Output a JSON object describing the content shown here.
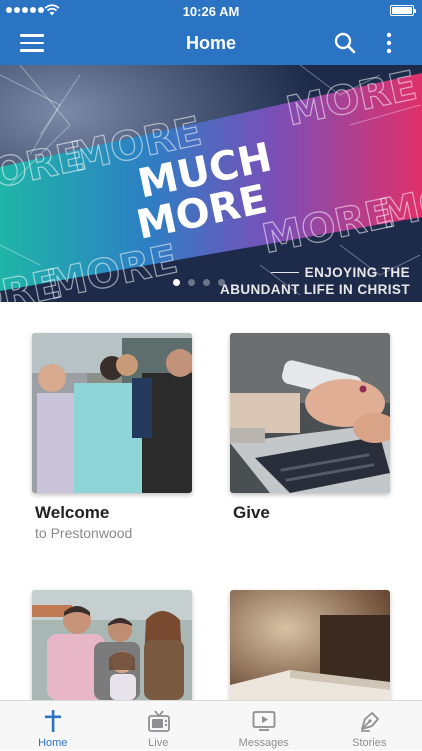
{
  "status_bar": {
    "time": "10:26 AM"
  },
  "nav": {
    "title": "Home"
  },
  "hero": {
    "title_line1": "MUCH",
    "title_line2": "MORE",
    "background_word": "MORE",
    "tagline_line1": "ENJOYING THE",
    "tagline_line2": "ABUNDANT LIFE IN CHRIST",
    "slide_count": 4,
    "active_slide": 1
  },
  "cards": [
    {
      "label": "Welcome",
      "sublabel": "to Prestonwood"
    },
    {
      "label": "Give",
      "sublabel": ""
    },
    {
      "label": "",
      "sublabel": ""
    },
    {
      "label": "",
      "sublabel": ""
    }
  ],
  "tabs": [
    {
      "label": "Home",
      "icon": "cross-icon",
      "active": true
    },
    {
      "label": "Live",
      "icon": "tv-icon",
      "active": false
    },
    {
      "label": "Messages",
      "icon": "play-screen-icon",
      "active": false
    },
    {
      "label": "Stories",
      "icon": "pen-nib-icon",
      "active": false
    }
  ],
  "colors": {
    "brand": "#2b73c3",
    "tab_inactive": "#8e8e93"
  }
}
